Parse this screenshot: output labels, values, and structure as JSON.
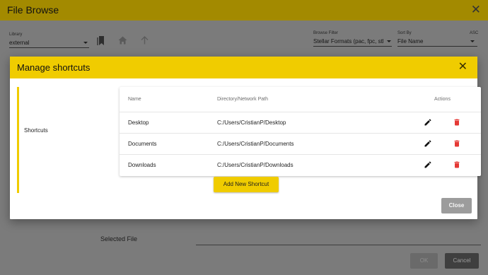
{
  "file_browse": {
    "title": "File Browse",
    "close_glyph": "✕",
    "library_label": "Library",
    "library_value": "external",
    "browse_filter_label": "Browse Filter",
    "browse_filter_value": "Stellar Formats (pac, fpc, stl,...",
    "sort_by_label": "Sort By",
    "sort_by_value": "File Name",
    "sort_order_label": "ASC",
    "selected_file_label": "Selected File",
    "ok_label": "OK",
    "cancel_label": "Cancel",
    "icons": [
      "bookmark-icon",
      "home-icon",
      "arrow-up-icon"
    ]
  },
  "modal": {
    "title": "Manage shortcuts",
    "close_glyph": "✕",
    "section_label": "Shortcuts",
    "columns": {
      "name": "Name",
      "path": "Directory/Network Path",
      "actions": "Actions"
    },
    "rows": [
      {
        "name": "Desktop",
        "path": "C:/Users/CristianP/Desktop"
      },
      {
        "name": "Documents",
        "path": "C:/Users/CristianP/Documents"
      },
      {
        "name": "Downloads",
        "path": "C:/Users/CristianP/Downloads"
      }
    ],
    "row_icons": [
      "pencil-edit-icon",
      "trash-delete-icon"
    ],
    "add_button": "Add New Shortcut",
    "close_button": "Close"
  },
  "colors": {
    "accent": "#f0cc00",
    "delete": "#e53935",
    "overlay_header": "#a38a00"
  }
}
